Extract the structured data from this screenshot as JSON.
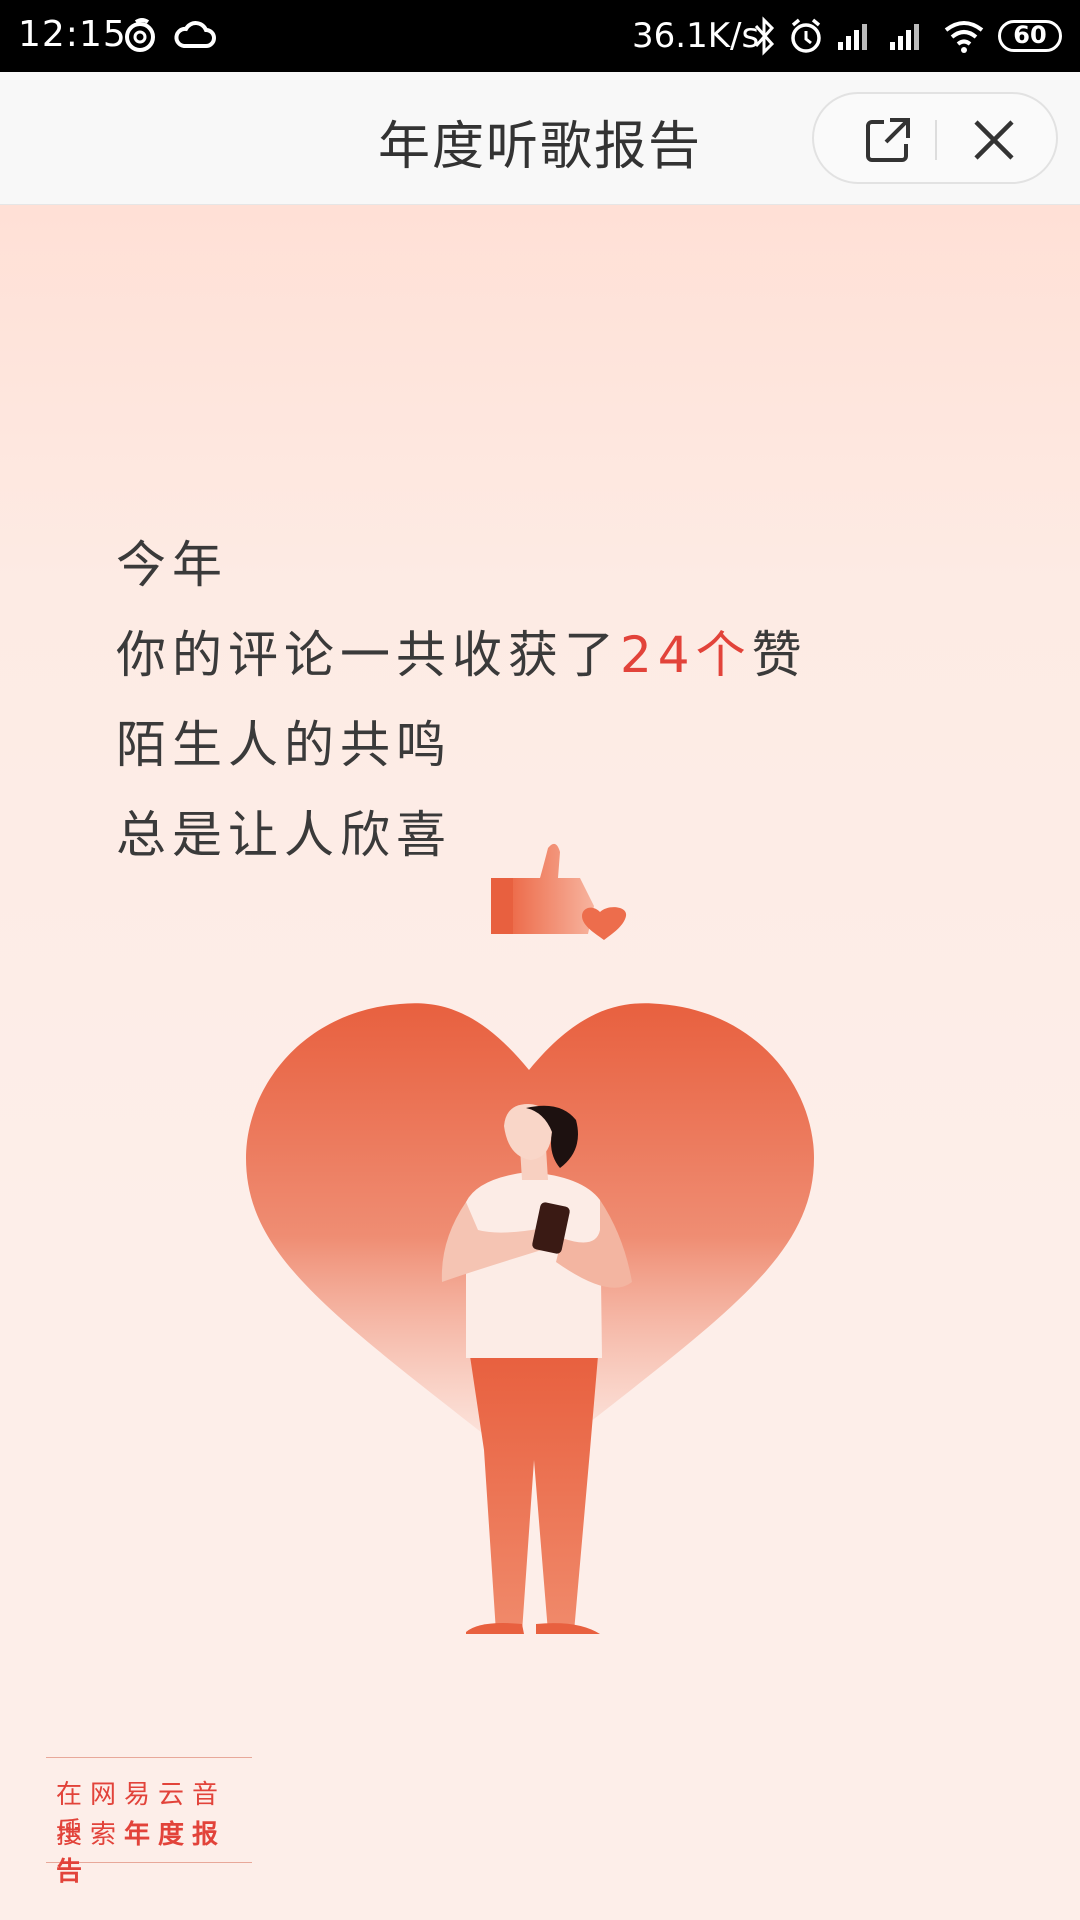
{
  "status_bar": {
    "time": "12:15",
    "speed": "36.1K/s",
    "battery": "60"
  },
  "header": {
    "title": "年度听歌报告"
  },
  "poem": {
    "line1": "今年",
    "line2_prefix": "你的评论一共收获了",
    "line2_highlight": "24个",
    "line2_suffix": "赞",
    "line3": "陌生人的共鸣",
    "line4": "总是让人欣喜"
  },
  "footer": {
    "line1": "在网易云音乐",
    "line2_prefix": "搜索",
    "line2_bold": "年度报告"
  },
  "colors": {
    "accent": "#e2433a",
    "heart": "#e8603f",
    "background": "#fdeee9"
  }
}
